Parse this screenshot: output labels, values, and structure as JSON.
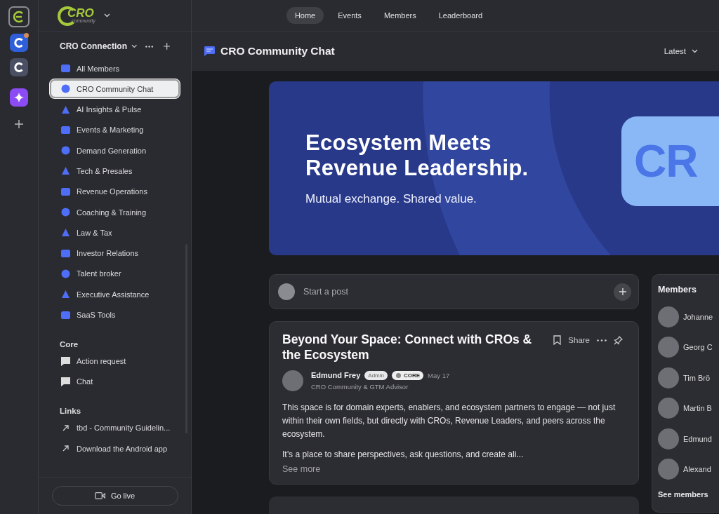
{
  "app_rail": {
    "items": [
      {
        "kind": "logo"
      },
      {
        "kind": "community",
        "notification": true
      },
      {
        "kind": "community",
        "notification": false
      },
      {
        "kind": "ai"
      },
      {
        "kind": "add"
      }
    ]
  },
  "logo": {
    "text": "CRO",
    "subtext": "community"
  },
  "nav_tabs": [
    {
      "label": "Home",
      "selected": true
    },
    {
      "label": "Events",
      "selected": false
    },
    {
      "label": "Members",
      "selected": false
    },
    {
      "label": "Leaderboard",
      "selected": false
    }
  ],
  "sidebar": {
    "group_title": "CRO Connection",
    "items": [
      {
        "label": "All Members",
        "selected": false
      },
      {
        "label": "CRO Community Chat",
        "selected": true
      },
      {
        "label": "AI Insights & Pulse",
        "selected": false
      },
      {
        "label": "Events & Marketing",
        "selected": false
      },
      {
        "label": "Demand Generation",
        "selected": false
      },
      {
        "label": "Tech & Presales",
        "selected": false
      },
      {
        "label": "Revenue Operations",
        "selected": false
      },
      {
        "label": "Coaching & Training",
        "selected": false
      },
      {
        "label": "Law & Tax",
        "selected": false
      },
      {
        "label": "Investor Relations",
        "selected": false
      },
      {
        "label": "Talent broker",
        "selected": false
      },
      {
        "label": "Executive Assistance",
        "selected": false
      },
      {
        "label": "SaaS Tools",
        "selected": false
      }
    ],
    "core_title": "Core",
    "core_items": [
      {
        "label": "Action request"
      },
      {
        "label": "Chat"
      }
    ],
    "links_title": "Links",
    "links": [
      {
        "label": "tbd - Community Guidelin..."
      },
      {
        "label": "Download the Android app"
      }
    ],
    "go_live": "Go live"
  },
  "header": {
    "title": "CRO Community Chat",
    "sort": "Latest"
  },
  "banner": {
    "headline": "Ecosystem Meets Revenue Leadership.",
    "subline": "Mutual exchange. Shared value.",
    "bubble_text": "CR"
  },
  "composer": {
    "placeholder": "Start a post"
  },
  "post": {
    "title": "Beyond Your Space: Connect with CROs & the Ecosystem",
    "share": "Share",
    "author": "Edmund Frey",
    "badges": [
      {
        "label": "Admin",
        "kind": "role"
      },
      {
        "label": "CORE",
        "kind": "tier"
      }
    ],
    "date": "May 17",
    "role": "CRO Community & GTM Advisor",
    "paragraphs": [
      "This space is for domain experts, enablers, and ecosystem partners to engage — not just within their own fields, but directly with CROs, Revenue Leaders, and peers across the ecosystem.",
      "It’s a place to share perspectives, ask questions, and create ali..."
    ],
    "see_more": "See more"
  },
  "members": {
    "title": "Members",
    "items": [
      {
        "name": "Johanne"
      },
      {
        "name": "Georg C"
      },
      {
        "name": "Tim Brö"
      },
      {
        "name": "Martin B"
      },
      {
        "name": "Edmund"
      },
      {
        "name": "Alexand"
      }
    ],
    "see_all": "See members"
  }
}
